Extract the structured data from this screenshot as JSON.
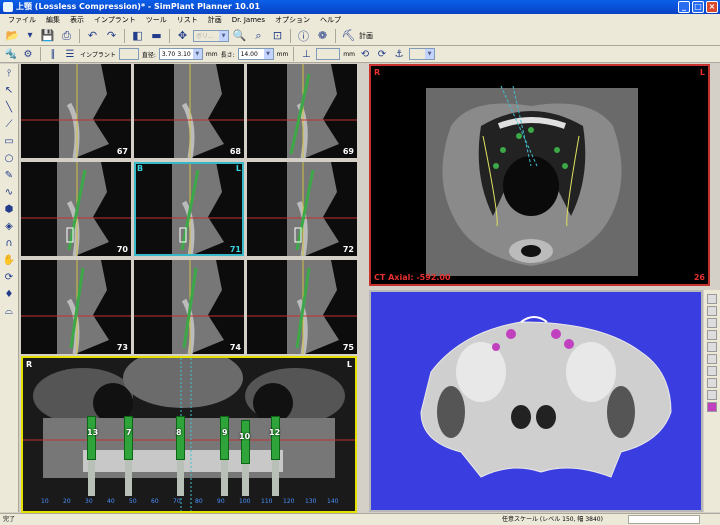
{
  "window": {
    "title": "上顎 (Lossless Compression)* - SimPlant Planner 10.01"
  },
  "menu": [
    "ファイル",
    "編集",
    "表示",
    "インプラント",
    "ツール",
    "リスト",
    "計画",
    "Dr. James",
    "オプション",
    "ヘルプ"
  ],
  "toolbar": {
    "mode_combo": "ボリ...",
    "plan_label": "計画"
  },
  "implant_toolbar": {
    "implant_label": "インプラント",
    "diameter_label": "直径:",
    "diameter_value": "3.70",
    "diameter_value2": "3.10",
    "mm": "mm",
    "length_label": "長さ:",
    "length_value": "14.00",
    "mm2": "mm",
    "mm3": "mm"
  },
  "cross_sections": [
    {
      "num": "67"
    },
    {
      "num": "68"
    },
    {
      "num": "69"
    },
    {
      "num": "70"
    },
    {
      "num": "71",
      "left": "B",
      "right": "L"
    },
    {
      "num": "72"
    },
    {
      "num": "73"
    },
    {
      "num": "74"
    },
    {
      "num": "75"
    }
  ],
  "panorama": {
    "left": "R",
    "right": "L",
    "ticks": [
      "10",
      "20",
      "30",
      "40",
      "50",
      "60",
      "70",
      "80",
      "90",
      "100",
      "110",
      "120",
      "130",
      "140"
    ],
    "implants": [
      "13",
      "7",
      "8",
      "9",
      "10",
      "12"
    ]
  },
  "axial": {
    "left": "R",
    "right": "L",
    "caption": "CT Axial: -592.00",
    "slice": "26"
  },
  "status": {
    "left": "完了",
    "scale": "任意スケール (レベル 150, 幅 3840)"
  },
  "colors": {
    "accent_green": "#2ea43a",
    "axial_border": "#c8302e",
    "panorama_border": "#e4e000",
    "view3d_bg": "#3a3ddf"
  }
}
